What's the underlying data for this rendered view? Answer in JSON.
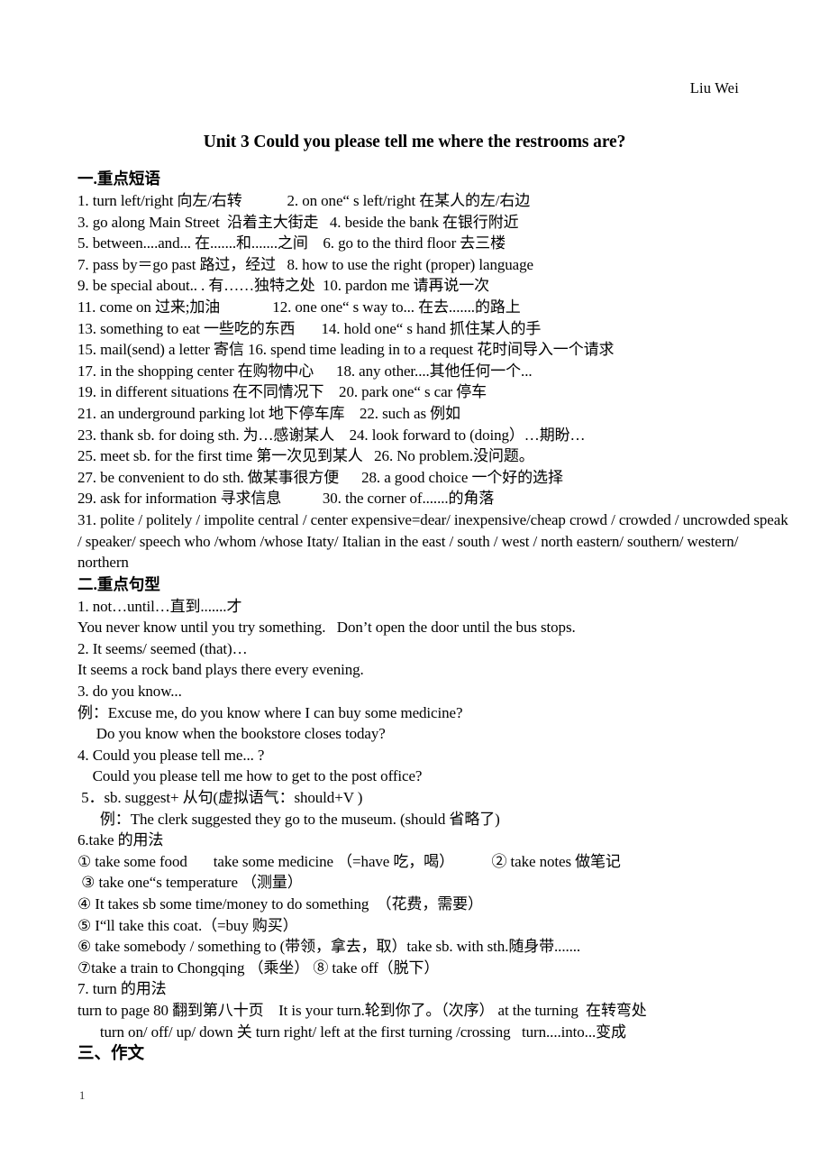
{
  "header": {
    "author": "Liu Wei"
  },
  "title": "Unit 3 Could you please tell me where the restrooms are?",
  "sections": {
    "phrases": {
      "heading": "一.重点短语",
      "lines": [
        "1. turn left/right 向左/右转            2. on one“ s left/right 在某人的左/右边",
        "3. go along Main Street  沿着主大街走   4. beside the bank 在银行附近",
        "5. between....and... 在.......和.......之间    6. go to the third floor 去三楼",
        "7. pass by＝go past 路过，经过   8. how to use the right (proper) language",
        "9. be special about.. . 有……独特之处  10. pardon me 请再说一次",
        "11. come on 过来;加油              12. one one“ s way to... 在去.......的路上",
        "13. something to eat 一些吃的东西       14. hold one“ s hand 抓住某人的手",
        "15. mail(send) a letter 寄信 16. spend time leading in to a request 花时间导入一个请求",
        "17. in the shopping center 在购物中心      18. any other....其他任何一个...",
        "19. in different situations 在不同情况下    20. park one“ s car 停车",
        "21. an underground parking lot 地下停车库    22. such as 例如",
        "23. thank sb. for doing sth. 为…感谢某人    24. look forward to (doing）…期盼…",
        "25. meet sb. for the first time 第一次见到某人   26. No problem.没问题。",
        "27. be convenient to do sth. 做某事很方便      28. a good choice 一个好的选择",
        "29. ask for information 寻求信息           30. the corner of.......的角落"
      ],
      "wrap_line": "31. polite / politely / impolite  central / center  expensive=dear/  inexpensive/cheap   crowd / crowded / uncrowded   speak / speaker/  speech  who /whom /whose Itaty/ Italian  in the east / south / west / north   eastern/ southern/ western/ northern"
    },
    "patterns": {
      "heading": "二.重点句型",
      "lines": [
        "1. not…until…直到.......才",
        "You never know until you try something.   Don’t open the door until the bus stops.",
        "2. It seems/ seemed (that)…",
        "It seems a rock band plays there every evening.",
        "3. do you know...",
        "例：Excuse me, do you know where I can buy some medicine?",
        "     Do you know when the bookstore closes today?",
        "4. Could you please tell me... ?",
        "    Could you please tell me how to get to the post office?",
        " 5．sb. suggest+ 从句(虚拟语气：should+V )",
        "      例：The clerk suggested they go to the museum. (should 省略了)"
      ]
    },
    "take_usage": {
      "heading": "6.take 的用法",
      "lines": [
        "① take some food       take some medicine （=have 吃，喝）          ② take notes 做笔记",
        " ③ take one“s temperature （测量）",
        "④ It takes sb some time/money to do something  （花费，需要）",
        "⑤ I“ll take this coat.（=buy 购买）",
        "⑥ take somebody / something to (带领，拿去，取）take sb. with sth.随身带.......",
        "⑦take a train to Chongqing （乘坐） ⑧ take off（脱下）"
      ]
    },
    "turn_usage": {
      "heading": "7. turn 的用法",
      "lines": [
        "turn to page 80 翻到第八十页    It is your turn.轮到你了。（次序） at the turning  在转弯处",
        "      turn on/ off/ up/ down 关 turn right/ left at the first turning /crossing   turn....into...变成"
      ]
    },
    "composition": {
      "heading": "三、作文"
    }
  },
  "footer": {
    "page_number": "1"
  }
}
